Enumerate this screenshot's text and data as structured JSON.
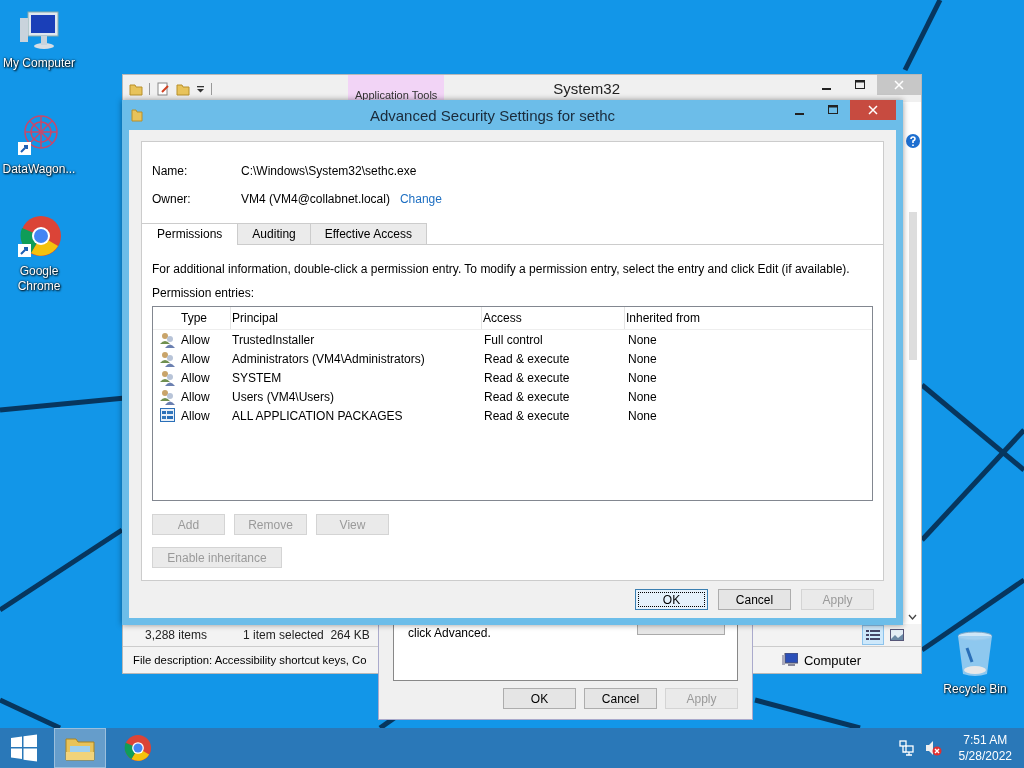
{
  "desktop_icons": [
    {
      "label": "My Computer",
      "kind": "computer"
    },
    {
      "label": "DataWagon...",
      "kind": "app-shortcut"
    },
    {
      "label": "Google Chrome",
      "kind": "chrome-shortcut"
    },
    {
      "label": "Recycle Bin",
      "kind": "recycle-bin"
    }
  ],
  "explorer": {
    "title": "System32",
    "context_tab": "Application Tools",
    "status_items": "3,288 items",
    "status_selected": "1 item selected  264 KB",
    "file_description": "File description: Accessibility shortcut keys, Co",
    "location": "Computer"
  },
  "properties_dialog": {
    "text": "click Advanced.",
    "buttons": [
      {
        "label": "OK",
        "disabled": false
      },
      {
        "label": "Cancel",
        "disabled": false
      },
      {
        "label": "Apply",
        "disabled": true
      }
    ]
  },
  "dialog": {
    "title": "Advanced Security Settings for sethc",
    "name_label": "Name:",
    "name_value": "C:\\Windows\\System32\\sethc.exe",
    "owner_label": "Owner:",
    "owner_value": "VM4 (VM4@collabnet.local)",
    "change_link": "Change",
    "tabs": [
      {
        "label": "Permissions",
        "selected": true
      },
      {
        "label": "Auditing",
        "selected": false
      },
      {
        "label": "Effective Access",
        "selected": false
      }
    ],
    "instructions": "For additional information, double-click a permission entry. To modify a permission entry, select the entry and click Edit (if available).",
    "entries_label": "Permission entries:",
    "columns": [
      "Type",
      "Principal",
      "Access",
      "Inherited from"
    ],
    "rows": [
      {
        "kind": "group",
        "type": "Allow",
        "principal": "TrustedInstaller",
        "access": "Full control",
        "inherited": "None"
      },
      {
        "kind": "group",
        "type": "Allow",
        "principal": "Administrators (VM4\\Administrators)",
        "access": "Read & execute",
        "inherited": "None"
      },
      {
        "kind": "group",
        "type": "Allow",
        "principal": "SYSTEM",
        "access": "Read & execute",
        "inherited": "None"
      },
      {
        "kind": "group",
        "type": "Allow",
        "principal": "Users (VM4\\Users)",
        "access": "Read & execute",
        "inherited": "None"
      },
      {
        "kind": "package",
        "type": "Allow",
        "principal": "ALL APPLICATION PACKAGES",
        "access": "Read & execute",
        "inherited": "None"
      }
    ],
    "actions": [
      {
        "label": "Add",
        "disabled": true
      },
      {
        "label": "Remove",
        "disabled": true
      },
      {
        "label": "View",
        "disabled": true
      }
    ],
    "inheritance_button": {
      "label": "Enable inheritance",
      "disabled": true
    },
    "buttons": [
      {
        "label": "OK",
        "disabled": false
      },
      {
        "label": "Cancel",
        "disabled": false
      },
      {
        "label": "Apply",
        "disabled": true
      }
    ]
  },
  "taskbar": {
    "apps": [
      {
        "kind": "explorer",
        "selected": true
      },
      {
        "kind": "chrome",
        "selected": false
      }
    ],
    "time": "7:51 AM",
    "date": "5/28/2022"
  }
}
